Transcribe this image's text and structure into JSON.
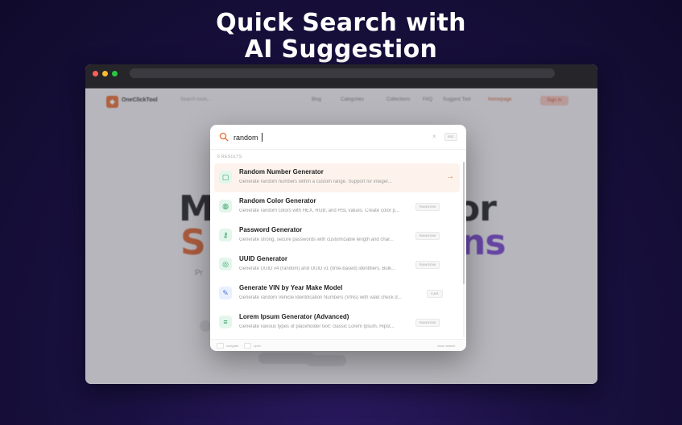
{
  "promo": {
    "title_line1": "Quick Search with",
    "title_line2": "AI Suggestion"
  },
  "browser": {
    "traffic_lights": [
      "#ff5f57",
      "#febc2e",
      "#28c840"
    ]
  },
  "site": {
    "logo": "OneClickTool",
    "search_hint": "Search tools...",
    "nav": [
      "Blog",
      "Categories",
      "Collections",
      "FAQ",
      "Suggest Tool",
      "Homepage",
      "Sign In"
    ],
    "hero_line1_left": "M",
    "hero_line1_right": "or",
    "hero_line2_left": "S",
    "hero_line2_right": "ns",
    "hero_sub": "Pr"
  },
  "search": {
    "icon": "search-icon",
    "value": "random",
    "clear_icon": "×",
    "esc_label": "ESC",
    "results_count": "6 RESULTS",
    "results": [
      {
        "title": "Random Number Generator",
        "description": "Generate random numbers within a custom range. Support for integer...",
        "icon": "number-icon",
        "icon_glyph": "▢",
        "badge": "",
        "active": true,
        "arrow": "→"
      },
      {
        "title": "Random Color Generator",
        "description": "Generate random colors with HEX, RGB, and HSL values. Create color p...",
        "icon": "palette-icon",
        "icon_glyph": "◍",
        "badge": "RANDOM",
        "active": false
      },
      {
        "title": "Password Generator",
        "description": "Generate strong, secure passwords with customizable length and char...",
        "icon": "key-icon",
        "icon_glyph": "⚷",
        "badge": "RANDOM",
        "active": false
      },
      {
        "title": "UUID Generator",
        "description": "Generate UUID v4 (random) and UUID v1 (time-based) identifiers. Bulk...",
        "icon": "fingerprint-icon",
        "icon_glyph": "◎",
        "badge": "RANDOM",
        "active": false
      },
      {
        "title": "Generate VIN by Year Make Model",
        "description": "Generate random Vehicle Identification Numbers (VINs) with valid check d...",
        "icon": "wrench-icon",
        "icon_glyph": "✎",
        "badge": "CAR",
        "active": false
      },
      {
        "title": "Lorem Ipsum Generator (Advanced)",
        "description": "Generate various types of placeholder text: classic Lorem Ipsum, Hipst...",
        "icon": "text-lines-icon",
        "icon_glyph": "≡",
        "badge": "RANDOM",
        "active": false
      }
    ],
    "footer": {
      "navigate": "navigate",
      "open": "open",
      "close": "close search"
    }
  }
}
